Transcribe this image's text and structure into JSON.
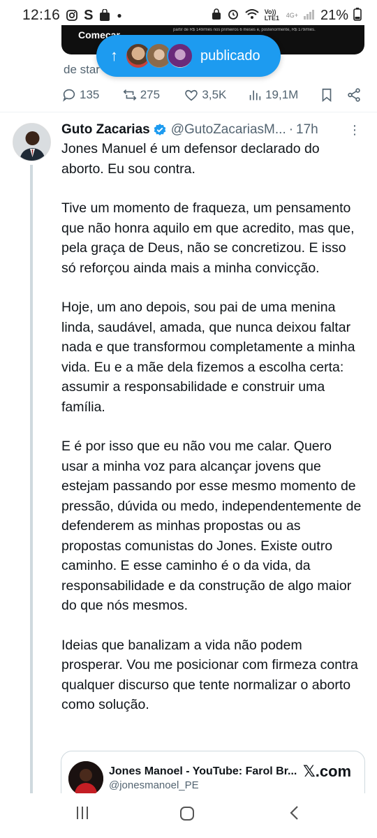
{
  "status_bar": {
    "time": "12:16",
    "left_icons": [
      "instagram-icon",
      "s-app-icon",
      "shopping-icon",
      "dot"
    ],
    "network": "Vo)) LTE1",
    "network_gen": "4G+",
    "battery": "21%"
  },
  "prev_tweet": {
    "card_title": "Começar",
    "card_small": "partir de R$ 149/mês nos primeiros 6 meses e, posteriormente, R$ 179/mês.",
    "subtext": "de star"
  },
  "new_posts_pill": {
    "label": "publicado"
  },
  "prev_actions": {
    "replies": "135",
    "reposts": "275",
    "likes": "3,5K",
    "views": "19,1M"
  },
  "tweet": {
    "author_name": "Guto Zacarias",
    "handle": "@GutoZacariasM...",
    "time": "17h",
    "paragraphs": [
      "Jones Manuel é um defensor declarado do aborto. Eu sou contra.",
      "Tive um momento de fraqueza, um pensamento que não honra aquilo em que acredito, mas que, pela graça de Deus, não se concretizou. E isso só reforçou ainda mais a minha convicção.",
      "Hoje, um ano depois, sou pai de uma menina linda, saudável, amada, que nunca deixou faltar nada e que transformou completamente a minha vida. Eu e a mãe dela fizemos a escolha certa: assumir a responsabilidade e construir uma família.",
      "E é por isso que eu não vou me calar. Quero usar a minha voz para alcançar jovens que estejam passando por esse mesmo momento de pressão, dúvida ou medo, independentemente de defenderem as minhas propostas ou as propostas comunistas do Jones. Existe outro caminho. E esse caminho é o da vida, da responsabilidade e da construção de algo maior do que nós mesmos.",
      "Ideias que banalizam a vida não podem prosperar. Vou me posicionar com firmeza contra qualquer discurso que tente normalizar o aborto como solução."
    ]
  },
  "link_card": {
    "title": "Jones Manoel - YouTube: Farol Br...",
    "handle": "@jonesmanoel_PE",
    "site": "𝕏.com"
  },
  "colors": {
    "accent": "#1d9bf0",
    "secondary_text": "#536471",
    "primary_text": "#0f1419"
  }
}
